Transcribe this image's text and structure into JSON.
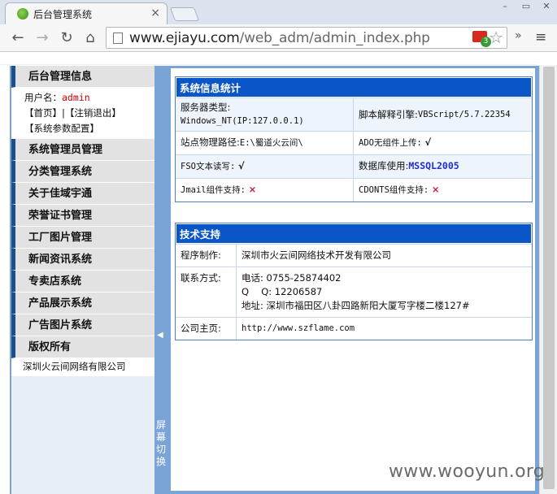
{
  "browser": {
    "tab_title": "后台管理系统",
    "tab_close": "×",
    "url_host": "www.ejiayu.com",
    "url_path": "/web_adm/admin_index.php",
    "badge_count": "3",
    "ext_label": "»",
    "menu_label": "≡"
  },
  "sidebar": {
    "header": "后台管理信息",
    "user_label": "用户名：",
    "user_name": "admin",
    "links_line1": "【首页】|【注销退出】",
    "links_line2": "【系统参数配置】",
    "items": [
      "系统管理员管理",
      "分类管理系统",
      "关于佳域宇通",
      "荣誉证书管理",
      "工厂图片管理",
      "新闻资讯系统",
      "专卖店系统",
      "产品展示系统",
      "广告图片系统",
      "版权所有"
    ],
    "footer": "深圳火云间网络有限公司"
  },
  "splitter": {
    "arrow": "◀",
    "text": "屏幕切换"
  },
  "stats": {
    "title": "系统信息统计",
    "server_type_label": "服务器类型:",
    "server_type_value": "Windows_NT(IP:127.0.0.1)",
    "script_engine_label": "脚本解释引擎:",
    "script_engine_value": "VBScript/5.7.22354",
    "physical_path_label": "站点物理路径:",
    "physical_path_value": "E:\\蜀道火云间\\",
    "ado_label": "ADO无组件上传:",
    "ado_value": "√",
    "fso_label": "FSO文本读写:",
    "fso_value": "√",
    "db_label": "数据库使用:",
    "db_value": "MSSQL2005",
    "jmail_label": "Jmail组件支持:",
    "jmail_value": "×",
    "cdonts_label": "CDONTS组件支持:",
    "cdonts_value": "×"
  },
  "support": {
    "title": "技术支持",
    "maker_label": "程序制作:",
    "maker_value": "深圳市火云间网络技术开发有限公司",
    "contact_label": "联系方式:",
    "phone": "电话: 0755-25874402",
    "qq": "Q　 Q: 12206587",
    "address": "地址: 深圳市福田区八卦四路新阳大厦写字楼二楼127#",
    "home_label": "公司主页:",
    "home_value": "http://www.szflame.com"
  },
  "watermark": "www.wooyun.org"
}
